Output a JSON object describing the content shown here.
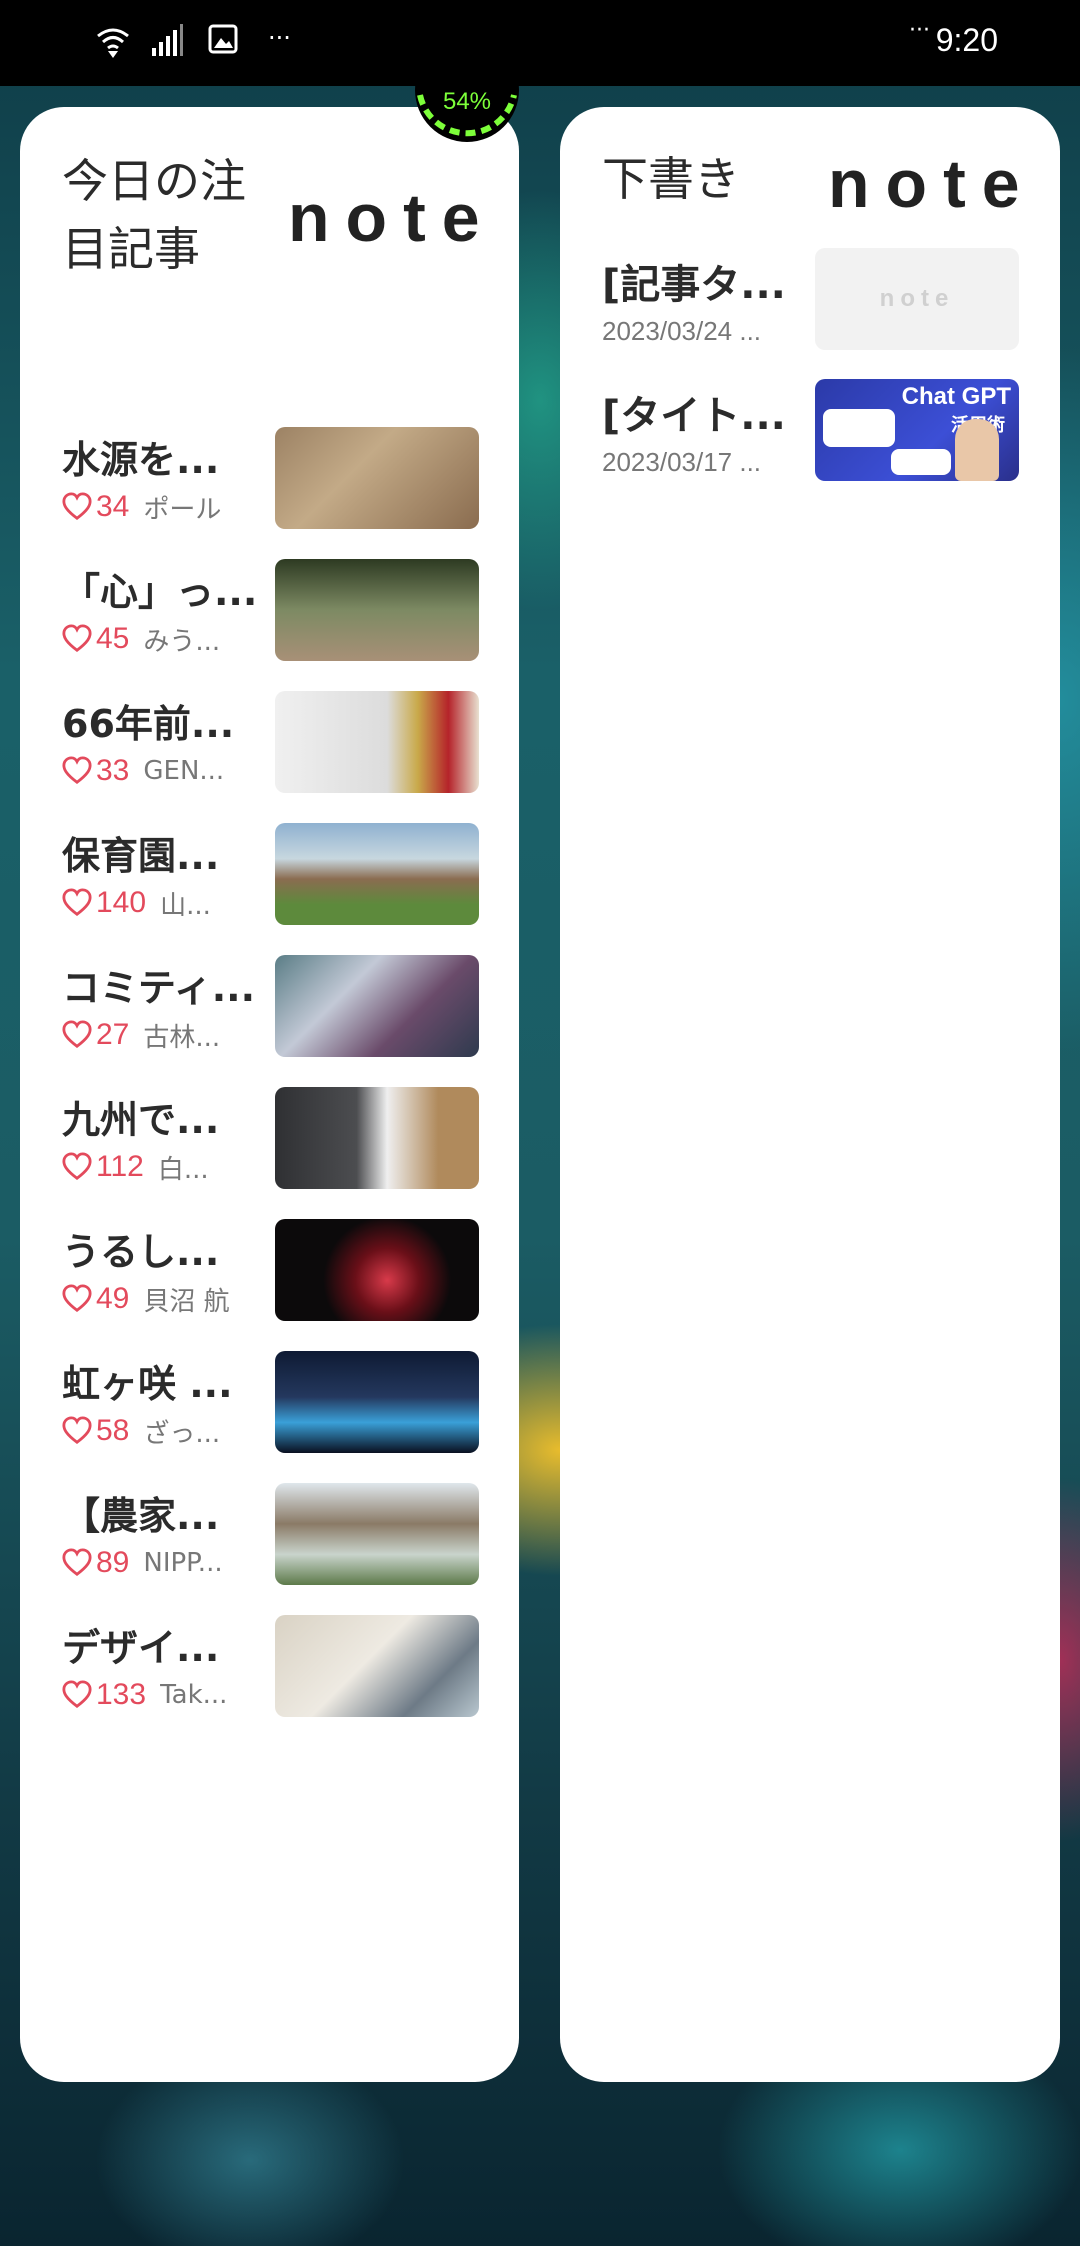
{
  "status_bar": {
    "time": "9:20",
    "dots_left": "···",
    "dots_right": "···",
    "icons": [
      "wifi-icon",
      "signal-icon",
      "image-icon"
    ]
  },
  "battery_widget": {
    "percent": "54%"
  },
  "left_widget": {
    "title_line1": "今日の注",
    "title_line2": "目記事",
    "logo": "note",
    "articles": [
      {
        "title": "水源を...",
        "likes": "34",
        "author": "ポール"
      },
      {
        "title": "「心」っ...",
        "likes": "45",
        "author": "みう..."
      },
      {
        "title": "66年前...",
        "likes": "33",
        "author": "GEN..."
      },
      {
        "title": "保育園...",
        "likes": "140",
        "author": "山..."
      },
      {
        "title": "コミティ...",
        "likes": "27",
        "author": "古林..."
      },
      {
        "title": "九州で...",
        "likes": "112",
        "author": "白..."
      },
      {
        "title": "うるし...",
        "likes": "49",
        "author": "貝沼 航"
      },
      {
        "title": "虹ヶ咲 ...",
        "likes": "58",
        "author": "ざっ..."
      },
      {
        "title": "【農家...",
        "likes": "89",
        "author": "NIPP..."
      },
      {
        "title": "デザイ...",
        "likes": "133",
        "author": "Tak..."
      }
    ]
  },
  "right_widget": {
    "title": "下書き",
    "logo": "note",
    "drafts": [
      {
        "title": "[記事タ...",
        "date": "2023/03/24 ...",
        "thumb_logo": "note"
      },
      {
        "title": "[タイト...",
        "date": "2023/03/17 ...",
        "thumb_label": "Chat GPT",
        "thumb_sub": "活用術"
      }
    ]
  },
  "colors": {
    "like_red": "#e34a5c",
    "battery_green": "#7dff3a"
  }
}
